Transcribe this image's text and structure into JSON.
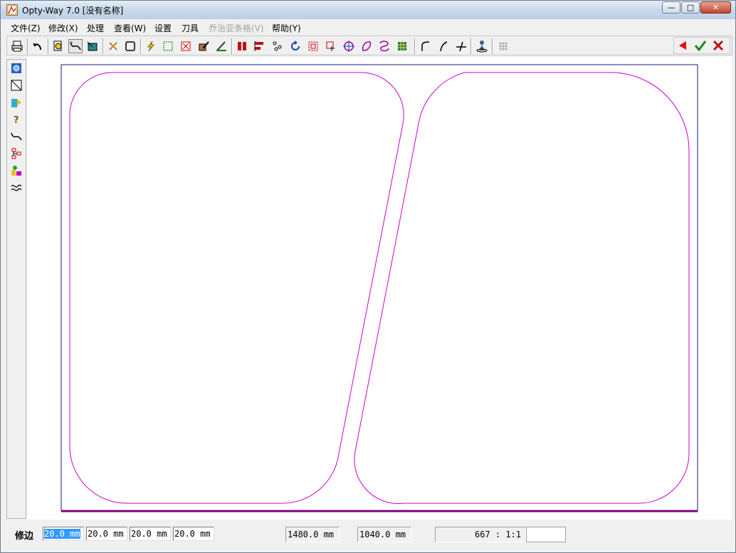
{
  "window": {
    "title": "Opty-Way 7.0  [没有名称]",
    "controls": {
      "minimize": "—",
      "maximize": "□",
      "close": "✕"
    }
  },
  "menu": [
    {
      "label": "文件(Z)",
      "enabled": true
    },
    {
      "label": "修改(X)",
      "enabled": true
    },
    {
      "label": "处理",
      "enabled": true
    },
    {
      "label": "查看(W)",
      "enabled": true
    },
    {
      "label": "设置",
      "enabled": true
    },
    {
      "label": "刀具",
      "enabled": true
    },
    {
      "label": "乔治亚条格(V)",
      "enabled": false
    },
    {
      "label": "帮助(Y)",
      "enabled": true
    }
  ],
  "toolbar": {
    "icons": [
      "print-icon",
      "undo-icon",
      "open-file-icon",
      "curve-tool-icon",
      "nest-tool-icon",
      "explode-icon",
      "rectangle-icon",
      "lightning-icon",
      "frame-icon",
      "cross-box-icon",
      "edit-icon",
      "knife-icon",
      "align-left-icon",
      "align-bar-icon",
      "scatter-icon",
      "rotate-icon",
      "scale-icon",
      "hand-icon",
      "target-icon",
      "shape-icon",
      "loop-icon",
      "grid-pattern-icon",
      "arc-icon",
      "feather-icon",
      "split-icon",
      "person-icon",
      "grid-icon"
    ],
    "actions": {
      "back_icon": "arrow-left-icon",
      "ok_icon": "check-icon",
      "cancel_icon": "x-mark-icon"
    },
    "colors": {
      "back": "#e01010",
      "ok": "#1a8a1a",
      "cancel": "#c01010"
    }
  },
  "left_tools": [
    "circle-select-icon",
    "diagonal-icon",
    "tag-icon",
    "question-icon",
    "curve-icon",
    "tree-icon",
    "paint-icon",
    "wave-icon"
  ],
  "drawing": {
    "sheet_border_color": "#1a1a8a",
    "shape_color": "#cc00cc",
    "baseline_color": "#800080"
  },
  "status": {
    "label": "修边",
    "fields": [
      "20.0 mm",
      "20.0 mm",
      "20.0 mm",
      "20.0 mm"
    ],
    "width": "1480.0 mm",
    "height": "1040.0 mm",
    "count_scale": "667 :   1:1"
  }
}
